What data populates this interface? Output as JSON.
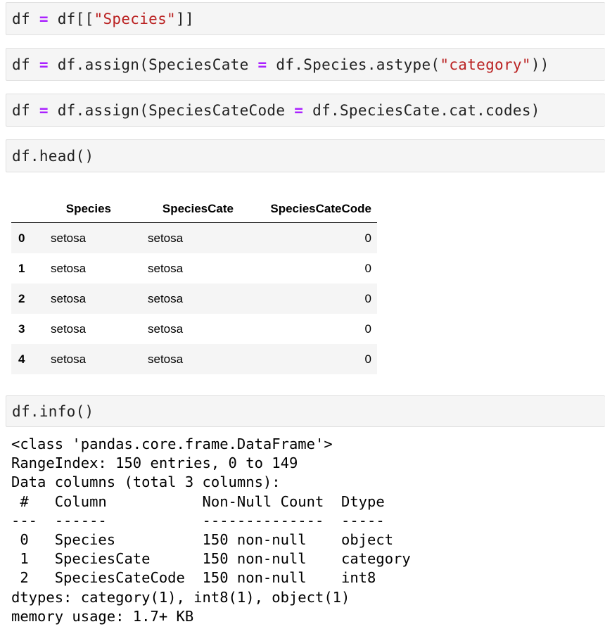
{
  "cells": [
    {
      "tokens": [
        [
          "df ",
          "t"
        ],
        [
          "=",
          "op"
        ],
        [
          " df[[",
          "t"
        ],
        [
          "\"Species\"",
          "str"
        ],
        [
          "]]",
          "t"
        ]
      ]
    },
    {
      "tokens": [
        [
          "df ",
          "t"
        ],
        [
          "=",
          "op"
        ],
        [
          " df.assign(SpeciesCate ",
          "t"
        ],
        [
          "=",
          "op"
        ],
        [
          " df.Species.astype(",
          "t"
        ],
        [
          "\"category\"",
          "str"
        ],
        [
          "))",
          "t"
        ]
      ]
    },
    {
      "tokens": [
        [
          "df ",
          "t"
        ],
        [
          "=",
          "op"
        ],
        [
          " df.assign(SpeciesCateCode ",
          "t"
        ],
        [
          "=",
          "op"
        ],
        [
          " df.SpeciesCate.cat.codes)",
          "t"
        ]
      ]
    },
    {
      "tokens": [
        [
          "df.head()",
          "t"
        ]
      ]
    },
    {
      "tokens": [
        [
          "df.info()",
          "t"
        ]
      ]
    }
  ],
  "dataframe": {
    "columns": [
      "Species",
      "SpeciesCate",
      "SpeciesCateCode"
    ],
    "rows": [
      {
        "index": "0",
        "Species": "setosa",
        "SpeciesCate": "setosa",
        "SpeciesCateCode": "0"
      },
      {
        "index": "1",
        "Species": "setosa",
        "SpeciesCate": "setosa",
        "SpeciesCateCode": "0"
      },
      {
        "index": "2",
        "Species": "setosa",
        "SpeciesCate": "setosa",
        "SpeciesCateCode": "0"
      },
      {
        "index": "3",
        "Species": "setosa",
        "SpeciesCate": "setosa",
        "SpeciesCateCode": "0"
      },
      {
        "index": "4",
        "Species": "setosa",
        "SpeciesCate": "setosa",
        "SpeciesCateCode": "0"
      }
    ]
  },
  "info_output": [
    "<class 'pandas.core.frame.DataFrame'>",
    "RangeIndex: 150 entries, 0 to 149",
    "Data columns (total 3 columns):",
    " #   Column           Non-Null Count  Dtype   ",
    "---  ------           --------------  -----   ",
    " 0   Species          150 non-null    object  ",
    " 1   SpeciesCate      150 non-null    category",
    " 2   SpeciesCateCode  150 non-null    int8    ",
    "dtypes: category(1), int8(1), object(1)",
    "memory usage: 1.7+ KB"
  ],
  "colors": {
    "cell_bg": "#f5f5f5",
    "operator": "#aa22ff",
    "string": "#ba2121",
    "stripe": "#f5f5f5"
  }
}
